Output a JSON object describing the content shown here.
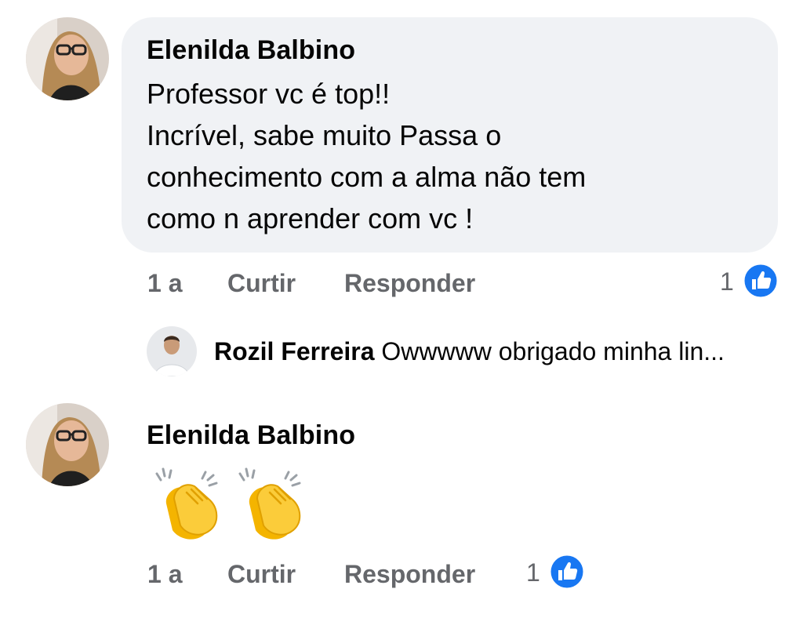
{
  "comments": [
    {
      "author": "Elenilda Balbino",
      "lines": [
        "Professor vc é top!!",
        "Incrível,  sabe muito Passa o",
        "conhecimento  com a alma não tem",
        "como n aprender com vc !"
      ],
      "time": "1 a",
      "like_label": "Curtir",
      "reply_label": "Responder",
      "reaction_count": "1",
      "reaction_icon": "like-icon"
    },
    {
      "author": "Elenilda Balbino",
      "emoji": [
        "👏",
        "👏"
      ],
      "time": "1 a",
      "like_label": "Curtir",
      "reply_label": "Responder",
      "reaction_count": "1",
      "reaction_icon": "like-icon"
    }
  ],
  "reply_preview": {
    "author": "Rozil Ferreira",
    "text": "Owwwww obrigado minha lin..."
  },
  "colors": {
    "bubble_bg": "#f0f2f5",
    "meta_text": "#65676b",
    "like_blue": "#1877f2"
  }
}
